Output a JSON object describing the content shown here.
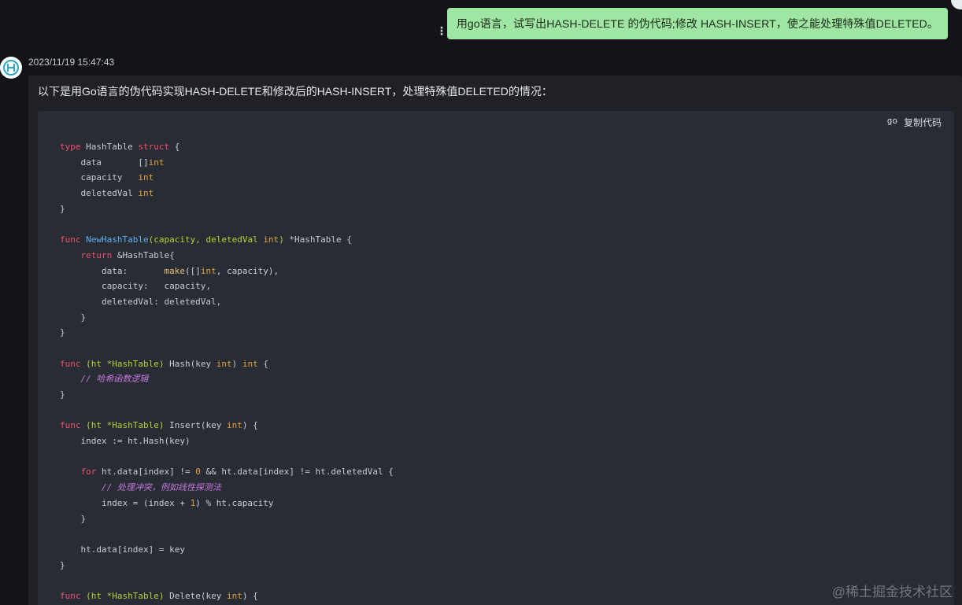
{
  "user_message": {
    "text": "用go语言，试写出HASH-DELETE 的伪代码;修改 HASH-INSERT，使之能处理特殊值DELETED。"
  },
  "bot_message": {
    "timestamp": "2023/11/19 15:47:43",
    "intro": "以下是用Go语言的伪代码实现HASH-DELETE和修改后的HASH-INSERT，处理特殊值DELETED的情况："
  },
  "code_block": {
    "language": "go",
    "copy_label": "复制代码",
    "lines": [
      [
        {
          "t": "type",
          "c": "kw"
        },
        {
          "t": " HashTable ",
          "c": "pl"
        },
        {
          "t": "struct",
          "c": "kw"
        },
        {
          "t": " {",
          "c": "pl"
        }
      ],
      [
        {
          "t": "    data       []",
          "c": "pl"
        },
        {
          "t": "int",
          "c": "ty"
        }
      ],
      [
        {
          "t": "    capacity   ",
          "c": "pl"
        },
        {
          "t": "int",
          "c": "ty"
        }
      ],
      [
        {
          "t": "    deletedVal ",
          "c": "pl"
        },
        {
          "t": "int",
          "c": "ty"
        }
      ],
      [
        {
          "t": "}",
          "c": "pl"
        }
      ],
      [],
      [
        {
          "t": "func",
          "c": "kw"
        },
        {
          "t": " ",
          "c": "pl"
        },
        {
          "t": "NewHashTable",
          "c": "fn"
        },
        {
          "t": "(capacity, deletedVal ",
          "c": "pm"
        },
        {
          "t": "int",
          "c": "ty"
        },
        {
          "t": ")",
          "c": "pm"
        },
        {
          "t": " *HashTable {",
          "c": "pl"
        }
      ],
      [
        {
          "t": "    ",
          "c": "pl"
        },
        {
          "t": "return",
          "c": "kw"
        },
        {
          "t": " &HashTable{",
          "c": "pl"
        }
      ],
      [
        {
          "t": "        data:       ",
          "c": "pl"
        },
        {
          "t": "make",
          "c": "bi"
        },
        {
          "t": "([]",
          "c": "pl"
        },
        {
          "t": "int",
          "c": "ty"
        },
        {
          "t": ", capacity),",
          "c": "pl"
        }
      ],
      [
        {
          "t": "        capacity:   capacity,",
          "c": "pl"
        }
      ],
      [
        {
          "t": "        deletedVal: deletedVal,",
          "c": "pl"
        }
      ],
      [
        {
          "t": "    }",
          "c": "pl"
        }
      ],
      [
        {
          "t": "}",
          "c": "pl"
        }
      ],
      [],
      [
        {
          "t": "func",
          "c": "kw"
        },
        {
          "t": " (ht *HashTable)",
          "c": "pm"
        },
        {
          "t": " Hash(key ",
          "c": "pl"
        },
        {
          "t": "int",
          "c": "ty"
        },
        {
          "t": ") ",
          "c": "pl"
        },
        {
          "t": "int",
          "c": "ty"
        },
        {
          "t": " {",
          "c": "pl"
        }
      ],
      [
        {
          "t": "    ",
          "c": "pl"
        },
        {
          "t": "// 哈希函数逻辑",
          "c": "cm"
        }
      ],
      [
        {
          "t": "}",
          "c": "pl"
        }
      ],
      [],
      [
        {
          "t": "func",
          "c": "kw"
        },
        {
          "t": " (ht *HashTable)",
          "c": "pm"
        },
        {
          "t": " Insert(key ",
          "c": "pl"
        },
        {
          "t": "int",
          "c": "ty"
        },
        {
          "t": ") {",
          "c": "pl"
        }
      ],
      [
        {
          "t": "    index := ht.Hash(key)",
          "c": "pl"
        }
      ],
      [],
      [
        {
          "t": "    ",
          "c": "pl"
        },
        {
          "t": "for",
          "c": "kw"
        },
        {
          "t": " ht.data[index] != ",
          "c": "pl"
        },
        {
          "t": "0",
          "c": "nm"
        },
        {
          "t": " && ht.data[index] != ht.deletedVal {",
          "c": "pl"
        }
      ],
      [
        {
          "t": "        ",
          "c": "pl"
        },
        {
          "t": "// 处理冲突，例如线性探测法",
          "c": "cm"
        }
      ],
      [
        {
          "t": "        index = (index + ",
          "c": "pl"
        },
        {
          "t": "1",
          "c": "nm"
        },
        {
          "t": ") % ht.capacity",
          "c": "pl"
        }
      ],
      [
        {
          "t": "    }",
          "c": "pl"
        }
      ],
      [],
      [
        {
          "t": "    ht.data[index] = key",
          "c": "pl"
        }
      ],
      [
        {
          "t": "}",
          "c": "pl"
        }
      ],
      [],
      [
        {
          "t": "func",
          "c": "kw"
        },
        {
          "t": " (ht *HashTable)",
          "c": "pm"
        },
        {
          "t": " Delete(key ",
          "c": "pl"
        },
        {
          "t": "int",
          "c": "ty"
        },
        {
          "t": ") {",
          "c": "pl"
        }
      ]
    ]
  },
  "watermark": "@稀土掘金技术社区",
  "colors": {
    "user_bubble": "#9fe6a2",
    "code_bg": "#282c34",
    "keyword": "#f0506e",
    "type": "#e5a03c",
    "function": "#61afef",
    "params": "#b5d334",
    "comment": "#c678dd"
  }
}
